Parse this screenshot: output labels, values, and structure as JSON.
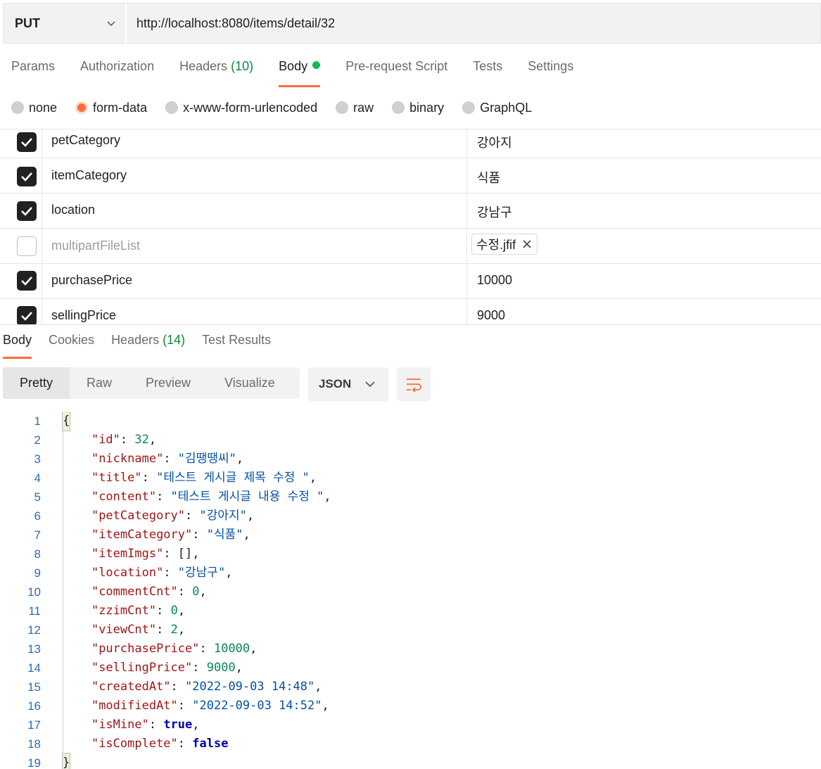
{
  "request": {
    "method": "PUT",
    "url": "http://localhost:8080/items/detail/32",
    "tabs": [
      {
        "label": "Params",
        "count": ""
      },
      {
        "label": "Authorization",
        "count": ""
      },
      {
        "label": "Headers",
        "count": "(10)"
      },
      {
        "label": "Body",
        "count": ""
      },
      {
        "label": "Pre-request Script",
        "count": ""
      },
      {
        "label": "Tests",
        "count": ""
      },
      {
        "label": "Settings",
        "count": ""
      }
    ],
    "active_tab": "Body",
    "body_modes": [
      "none",
      "form-data",
      "x-www-form-urlencoded",
      "raw",
      "binary",
      "GraphQL"
    ],
    "selected_body_mode": "form-data",
    "form_rows": [
      {
        "key": "petCategory",
        "value": "강아지",
        "checked": true
      },
      {
        "key": "itemCategory",
        "value": "식품",
        "checked": true
      },
      {
        "key": "location",
        "value": "강남구",
        "checked": true
      },
      {
        "key": "multipartFileList",
        "value": "수정.jfif",
        "checked": false,
        "is_file": true
      },
      {
        "key": "purchasePrice",
        "value": "10000",
        "checked": true
      },
      {
        "key": "sellingPrice",
        "value": "9000",
        "checked": true
      }
    ]
  },
  "response": {
    "tabs": [
      {
        "label": "Body",
        "count": ""
      },
      {
        "label": "Cookies",
        "count": ""
      },
      {
        "label": "Headers",
        "count": "(14)"
      },
      {
        "label": "Test Results",
        "count": ""
      }
    ],
    "active_tab": "Body",
    "view_modes": [
      "Pretty",
      "Raw",
      "Preview",
      "Visualize"
    ],
    "active_view": "Pretty",
    "format": "JSON",
    "lines": [
      {
        "num": "1",
        "text": "{"
      },
      {
        "num": "2",
        "key": "\"id\"",
        "value": "32",
        "type": "n",
        "comma": ","
      },
      {
        "num": "3",
        "key": "\"nickname\"",
        "value": "\"김땡땡씨\"",
        "type": "s",
        "comma": ","
      },
      {
        "num": "4",
        "key": "\"title\"",
        "value": "\"테스트 게시글 제목 수정 \"",
        "type": "s",
        "comma": ","
      },
      {
        "num": "5",
        "key": "\"content\"",
        "value": "\"테스트 게시글 내용 수정 \"",
        "type": "s",
        "comma": ","
      },
      {
        "num": "6",
        "key": "\"petCategory\"",
        "value": "\"강아지\"",
        "type": "s",
        "comma": ","
      },
      {
        "num": "7",
        "key": "\"itemCategory\"",
        "value": "\"식품\"",
        "type": "s",
        "comma": ","
      },
      {
        "num": "8",
        "key": "\"itemImgs\"",
        "value": "[]",
        "type": "p",
        "comma": ","
      },
      {
        "num": "9",
        "key": "\"location\"",
        "value": "\"강남구\"",
        "type": "s",
        "comma": ","
      },
      {
        "num": "10",
        "key": "\"commentCnt\"",
        "value": "0",
        "type": "n",
        "comma": ","
      },
      {
        "num": "11",
        "key": "\"zzimCnt\"",
        "value": "0",
        "type": "n",
        "comma": ","
      },
      {
        "num": "12",
        "key": "\"viewCnt\"",
        "value": "2",
        "type": "n",
        "comma": ","
      },
      {
        "num": "13",
        "key": "\"purchasePrice\"",
        "value": "10000",
        "type": "n",
        "comma": ","
      },
      {
        "num": "14",
        "key": "\"sellingPrice\"",
        "value": "9000",
        "type": "n",
        "comma": ","
      },
      {
        "num": "15",
        "key": "\"createdAt\"",
        "value": "\"2022-09-03 14:48\"",
        "type": "s",
        "comma": ","
      },
      {
        "num": "16",
        "key": "\"modifiedAt\"",
        "value": "\"2022-09-03 14:52\"",
        "type": "s",
        "comma": ","
      },
      {
        "num": "17",
        "key": "\"isMine\"",
        "value": "true",
        "type": "b",
        "comma": ","
      },
      {
        "num": "18",
        "key": "\"isComplete\"",
        "value": "false",
        "type": "b",
        "comma": ""
      },
      {
        "num": "19",
        "text": "}"
      }
    ]
  },
  "colors": {
    "accent": "#ff6c37",
    "success": "#0cbb52",
    "count": "#0f8a3c"
  },
  "icons": {
    "method_dropdown": "chevron-down-icon",
    "format_dropdown": "chevron-down-icon",
    "wrap": "wrap-lines-icon",
    "remove_file": "close-icon",
    "checkbox": "check-icon"
  }
}
